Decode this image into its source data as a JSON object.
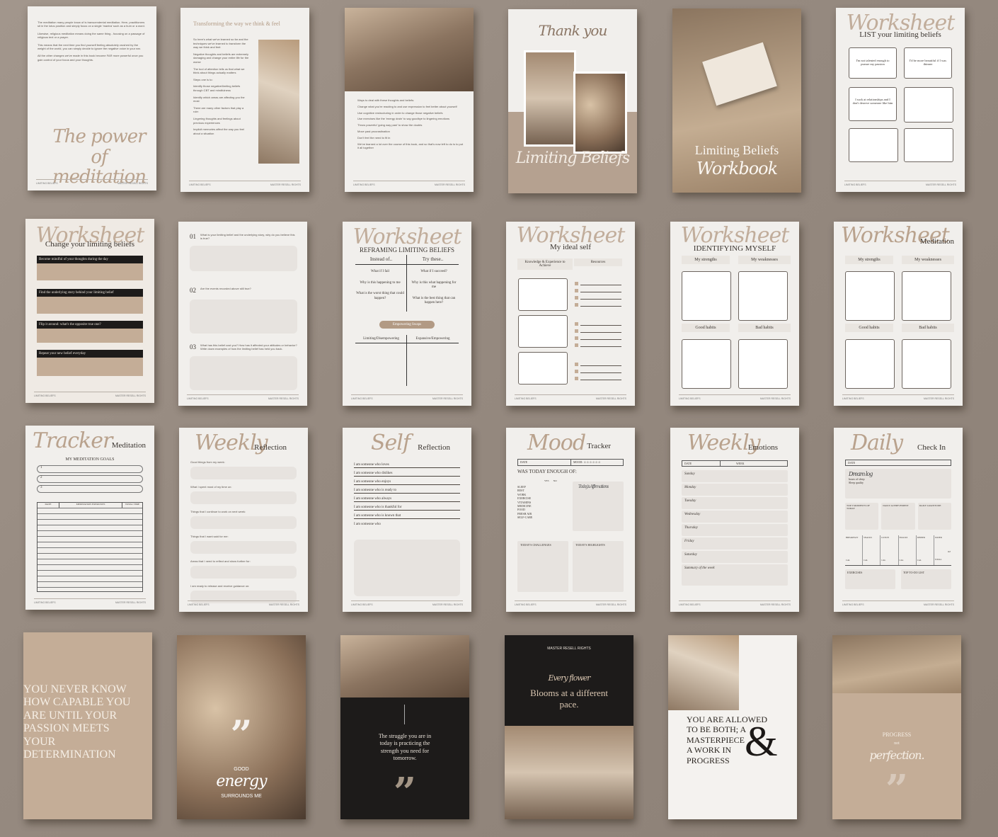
{
  "footer": {
    "left": "LIMITING BELIEFS",
    "right": "MASTER RESELL RIGHTS"
  },
  "row1": {
    "p1": {
      "script_title": "The power of meditation",
      "body": [
        "The meditation many people know of is transcendental meditation. Here, practitioners sit in the lotus position and simply focus on a single 'mantra' such as a hum or a word.",
        "Likewise, religious meditation means doing the same thing - focusing on a passage of religious text or a prayer.",
        "This means that the next time you find yourself feeling absolutely crushed by the weight of the world, you can simply decide to ignore the negative voice in your ear.",
        "All the other changes we've made in this book become FAR more powerful once you gain control of your focus and your thoughts."
      ]
    },
    "p2": {
      "heading": "Transforming the way we think & feel",
      "body": [
        "So here's what we've learned so far and the techniques we've learned to transform the way we think and feel:",
        "Negative thoughts and beliefs are extremely damaging and change your entire life for the worse",
        "The tool of attention tells us that what we think about things actually matters",
        "Steps one is to:",
        "Identify those negative/limiting beliefs through CBT and mindfulness",
        "Identify which areas are affecting you the most",
        "There are many other factors that play a role:",
        "Lingering thoughts and feelings about previous experiences",
        "Implicit memories affect the way you feel about a situation"
      ]
    },
    "p3": {
      "body": [
        "Ways to deal with these thoughts and beliefs:",
        "Change what you're reacting to and use expression to feel better about yourself",
        "Use cognitive restructuring in order to change those negative beliefs",
        "Use exercises like the 'energy drain' to say goodbye to lingering emotions",
        "Throw powerful 'going way past' to show the doubts",
        "Move past procrastination",
        "Don't feel the need to fit in",
        "We've learned a lot over the course of this book, and so that's now left to do is to put it all together"
      ]
    },
    "p4": {
      "script_top": "Thank you",
      "script_bottom": "Limiting Beliefs"
    },
    "p5": {
      "title": "Limiting Beliefs",
      "script": "Workbook"
    },
    "p6": {
      "script": "Worksheet",
      "subtitle": "LIST your limiting beliefs",
      "boxes": [
        "I'm not talented enough to pursue my passion",
        "I'd be more beautiful if I was thinner",
        "I suck at relationships and I don't deserve someone like him",
        "",
        "",
        ""
      ]
    }
  },
  "row2": {
    "p1": {
      "script": "Worksheet",
      "subtitle": "Change your limiting beliefs",
      "bars": [
        "Become mindful of your thoughts during the day",
        "Find the underlying story behind your limiting belief",
        "Flip it around: what's the opposite true one?",
        "Repeat your new belief everyday"
      ]
    },
    "p2": {
      "items": [
        {
          "num": "01",
          "q": "What is your limiting belief and the underlying story, why do you believe this is true?"
        },
        {
          "num": "02",
          "q": "Are the events recorded above still true?"
        },
        {
          "num": "03",
          "q": "What has this belief cost you? How has it affected your attitudes or behavior? Write down examples of how the limiting belief has held you back."
        }
      ]
    },
    "p3": {
      "script": "Worksheet",
      "subtitle": "REFRAMING LIMITING BELIEFS",
      "cols": [
        "Instead of..",
        "Try these.."
      ],
      "left": [
        "What if I fail",
        "Why is this happening to me",
        "What is the worst thing that could happen?"
      ],
      "right": [
        "What if I succeed?",
        "Why is this what happening for me",
        "What is the best thing that can happen here?"
      ],
      "badge": "Empowering Swaps",
      "cols2": [
        "Limiting/Disempowering",
        "Expansive/Empowering"
      ]
    },
    "p4": {
      "script": "Worksheet",
      "subtitle": "My ideal self",
      "labels": [
        "Knowledge & Experience to Achieve",
        "Resources"
      ]
    },
    "p5": {
      "script": "Worksheet",
      "subtitle": "IDENTIFYING MYSELF",
      "labels": [
        "My strengths",
        "My weaknesses",
        "Good habits",
        "Bad habits"
      ]
    },
    "p6": {
      "script": "Worksheet",
      "subtitle": "Meditation",
      "labels": [
        "My strengths",
        "My weaknesses",
        "Good habits",
        "Bad habits"
      ]
    }
  },
  "row3": {
    "p1": {
      "script": "Tracker",
      "subtitle": "Meditation",
      "goals_title": "MY MEDITATION GOALS",
      "goals": [
        "1",
        "2",
        "3"
      ],
      "cols": [
        "DATE",
        "MEDITATION EXERCISES",
        "TOTAL TIME"
      ]
    },
    "p2": {
      "script": "Weekly",
      "subtitle": "Reflection",
      "prompts": [
        "Good things from my week:",
        "What I spent most of my time on:",
        "Things that I continue to work on next week:",
        "Things that I want said for me:",
        "Areas that I need to reflect and show further for:",
        "I am ready to release and receive guidance on:"
      ]
    },
    "p3": {
      "script": "Self",
      "subtitle": "Reflection",
      "lines": [
        "I am someone who loves",
        "I am someone who dislikes",
        "I am someone who enjoys",
        "I am someone who is ready to",
        "I am someone who always",
        "I am someone who is thankful for",
        "I am someone who is known that",
        "I am someone who"
      ]
    },
    "p4": {
      "script": "Mood",
      "subtitle": "Tracker",
      "date": "DATE",
      "mood": "MOOD:",
      "question": "WAS TODAY ENOUGH OF:",
      "yes": "YES",
      "no": "NO",
      "items": [
        "SLEEP",
        "REST",
        "WORK",
        "EXERCISE",
        "VITAMINS",
        "MEDICINE",
        "FOOD",
        "FRESH AIR",
        "SELF-CARE"
      ],
      "affirm": "Today's Affirmations",
      "challenges": "TODAY'S CHALLENGES",
      "highlights": "TODAY'S HIGHLIGHTS"
    },
    "p5": {
      "script": "Weekly",
      "subtitle": "Emotions",
      "date": "DATE",
      "week": "WEEK",
      "days": [
        "Sunday",
        "Monday",
        "Tuesday",
        "Wednesday",
        "Thursday",
        "Friday",
        "Saturday",
        "Summary of the week"
      ]
    },
    "p6": {
      "script": "Daily",
      "subtitle": "Check In",
      "date": "DATE",
      "dream": "Dream log",
      "sleep": [
        "hours of sleep",
        "Sleep quality"
      ],
      "cols": [
        "TOP 3 MOMENTS OF TODAY",
        "DAILY ACHIEVEMENT",
        "DAILY GRATITUDE"
      ],
      "meals": [
        "BREAKFAST",
        "SNACKS",
        "LUNCH",
        "SNACKS",
        "DINNER",
        "WATER"
      ],
      "cal": "CAL",
      "oz": "OZ",
      "total": "TOTAL",
      "bottom": [
        "EXERCISES",
        "TOP TO-DO LIST"
      ]
    }
  },
  "row4": {
    "p1": {
      "lines": [
        "YOU NEVER KNOW",
        "HOW CAPABLE YOU",
        "ARE UNTIL YOUR",
        "PASSION MEETS",
        "YOUR",
        "DETERMINATION"
      ]
    },
    "p2": {
      "top": "GOOD",
      "script": "energy",
      "bottom": "SURROUNDS ME"
    },
    "p3": {
      "text": "The struggle you are in today is practicing the strength you need for tomorrow."
    },
    "p4": {
      "brand": "MASTER RESELL RIGHTS",
      "script": "Every flower",
      "text": "Blooms at a different pace."
    },
    "p5": {
      "lines": [
        "YOU ARE ALLOWED",
        "TO BE BOTH; A",
        "MASTERPIECE",
        "A WORK IN",
        "PROGRESS"
      ],
      "amp": "&"
    },
    "p6": {
      "top": "PROGRESS",
      "mid": "not",
      "script": "perfection."
    }
  },
  "colors": {
    "background": "#968a80",
    "paper": "#f1efec",
    "accent": "#b9a28d",
    "dark": "#1d1b1a",
    "tan": "#c4ad97"
  }
}
